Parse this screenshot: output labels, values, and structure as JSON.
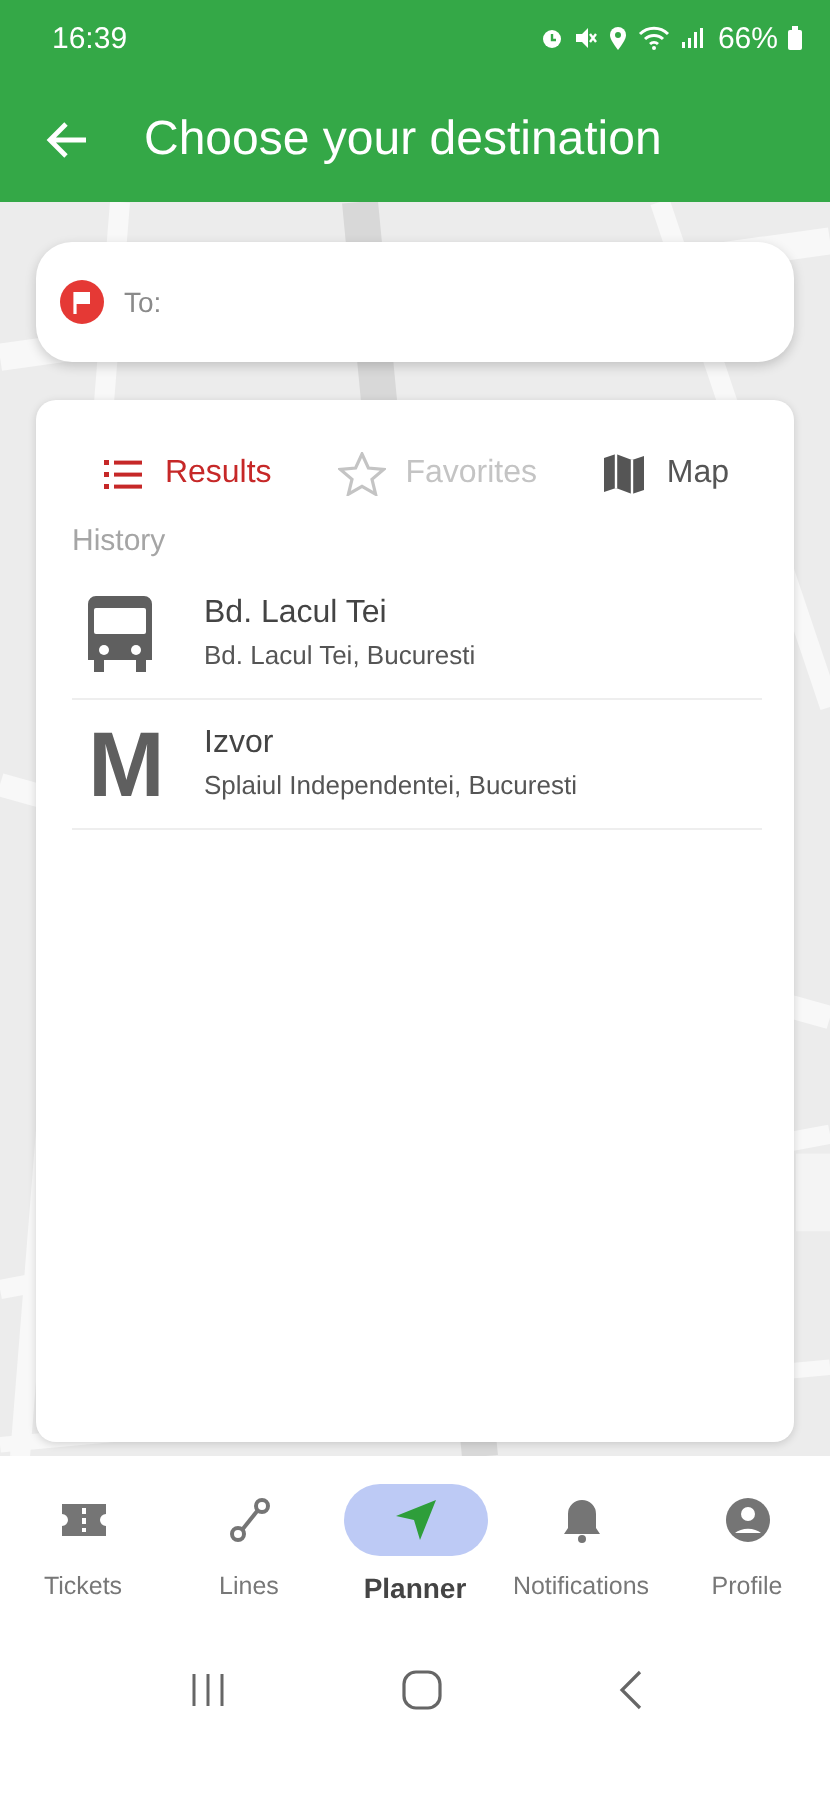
{
  "status_bar": {
    "time": "16:39",
    "battery": "66%"
  },
  "app_bar": {
    "title": "Choose your destination"
  },
  "search": {
    "placeholder": "To:"
  },
  "tabs": [
    {
      "label": "Results",
      "kind": "list",
      "selected": true,
      "disabled": false
    },
    {
      "label": "Favorites",
      "kind": "star",
      "selected": false,
      "disabled": true
    },
    {
      "label": "Map",
      "kind": "map",
      "selected": false,
      "disabled": false
    }
  ],
  "history": {
    "title": "History",
    "items": [
      {
        "kind": "bus",
        "name": "Bd. Lacul Tei",
        "address": "Bd. Lacul Tei, Bucuresti"
      },
      {
        "kind": "metro",
        "icon_text": "M",
        "name": "Izvor",
        "address": "Splaiul Independentei, Bucuresti"
      }
    ]
  },
  "bottom_nav": [
    {
      "label": "Tickets",
      "kind": "ticket",
      "selected": false
    },
    {
      "label": "Lines",
      "kind": "route",
      "selected": false
    },
    {
      "label": "Planner",
      "kind": "navigate",
      "selected": true
    },
    {
      "label": "Notifications",
      "kind": "bell",
      "selected": false
    },
    {
      "label": "Profile",
      "kind": "person",
      "selected": false
    }
  ]
}
